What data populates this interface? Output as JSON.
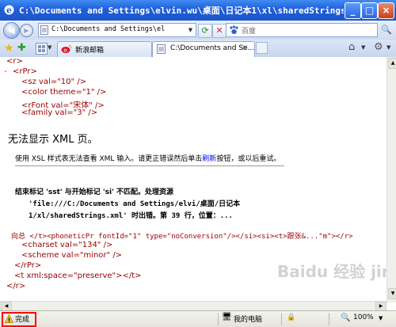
{
  "window": {
    "title": "C:\\Documents and Settings\\elvin.wu\\桌面\\日记本1\\xl\\sharedStrings.xml..."
  },
  "address": {
    "url": "C:\\Documents and Settings\\el",
    "search_placeholder": "百度"
  },
  "tabs": [
    {
      "label": "新浪邮箱"
    },
    {
      "label": "C:\\Documents and Se..."
    }
  ],
  "xml_top": {
    "line1": "<r>",
    "line2_prefix": "- ",
    "line2_tag": "<rPr>",
    "sz": "<sz val=\"10\" />",
    "color": "<color theme=\"1\" />",
    "rfont": "<rFont val=\"宋体\" />",
    "family": "<family val=\"3\" />"
  },
  "error": {
    "heading": "无法显示 XML 页。",
    "desc_before": "使用 XSL 样式表无法查看 XML 输入。请更正错误然后单击",
    "refresh_link": "刷新",
    "desc_after": "按钮，或以后重试。",
    "msg1": "结束标记 'sst' 与开始标记 'si' 不匹配。处理资源",
    "msg2": "'file:///C:/Documents and Settings/elvi/桌面/日记本",
    "msg3": "1/xl/sharedStrings.xml' 时出错。第 39 行，位置：..."
  },
  "xml_bottom": {
    "line1": "向总 </t><phoneticPr fontId=\"1\" type=\"noConversion\"/></si><si><t>跟张&...\"m\">",
    "line1_end": "</r>",
    "charset": "<charset val=\"134\" />",
    "scheme": "<scheme val=\"minor\" />",
    "rpr_close": "</rPr>",
    "t_open": "<t xml:space=\"preserve\"></t>",
    "r_close": "</r>"
  },
  "status": {
    "text": "完成",
    "zone": "我的电脑",
    "zoom": "100%"
  },
  "watermark": "Baidu 经验 jingyan.baidu.com",
  "colors": {
    "titlebar": "#1f5fd8",
    "xml_tag": "#990000",
    "xml_value": "#0000ff",
    "link": "#0000ff",
    "highlight_box": "#ff0000"
  }
}
